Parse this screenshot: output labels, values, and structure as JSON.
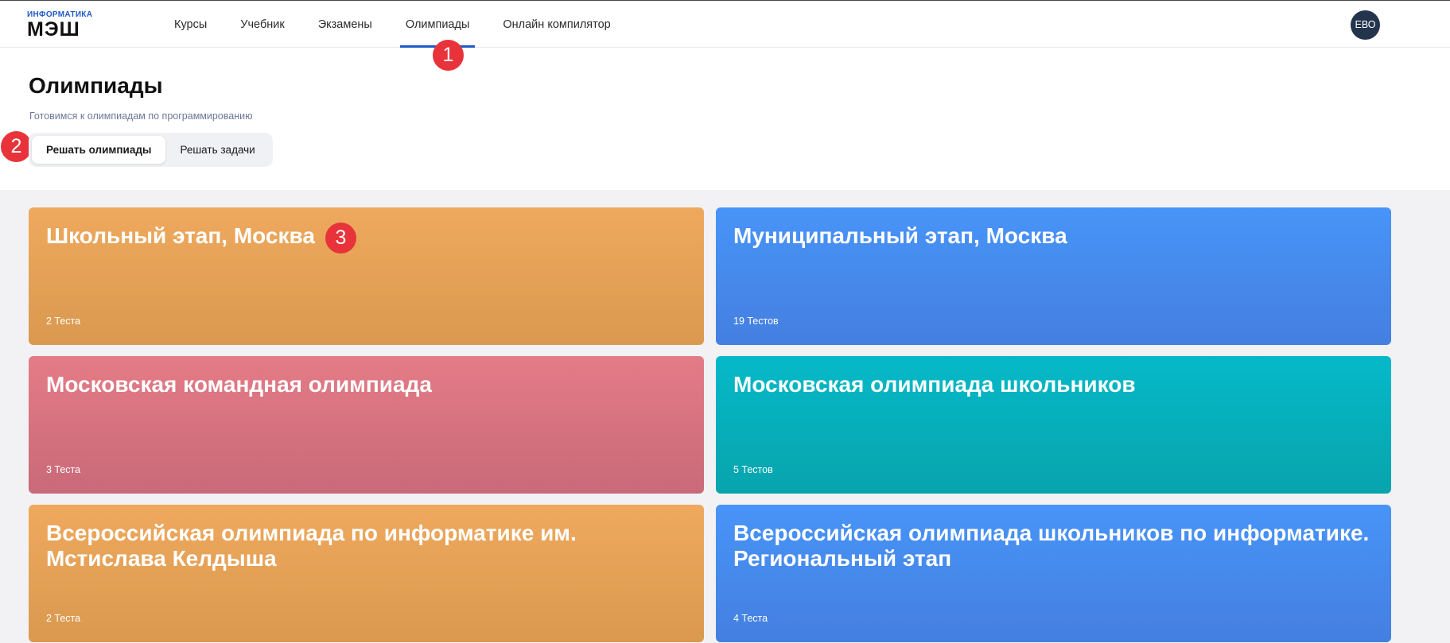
{
  "logo": {
    "small": "ИНФОРМАТИКА",
    "big": "МЭШ"
  },
  "nav": {
    "items": [
      {
        "label": "Курсы"
      },
      {
        "label": "Учебник"
      },
      {
        "label": "Экзамены"
      },
      {
        "label": "Олимпиады"
      },
      {
        "label": "Онлайн компилятор"
      }
    ],
    "active": "Олимпиады"
  },
  "user": {
    "initials": "ЕВО"
  },
  "badges": {
    "b1": "1",
    "b2": "2",
    "b3": "3"
  },
  "page": {
    "title": "Олимпиады",
    "subtitle": "Готовимся к олимпиадам по программированию"
  },
  "tabs": {
    "solve_olympiads": "Решать олимпиады",
    "solve_tasks": "Решать задачи"
  },
  "cards": [
    {
      "title": "Школьный этап, Москва",
      "count": "2 Теста",
      "color": "#efa95e"
    },
    {
      "title": "Муниципальный этап, Москва",
      "count": "19 Тестов",
      "color": "#4894f8"
    },
    {
      "title": "Московская командная олимпиада",
      "count": "3 Теста",
      "color": "#e47c86"
    },
    {
      "title": "Московская олимпиада школьников",
      "count": "5 Тестов",
      "color": "#06b9c8"
    },
    {
      "title": "Всероссийская олимпиада по информатике им. Мстислава Келдыша",
      "count": "2 Теста",
      "color": "#efa95e"
    },
    {
      "title": "Всероссийская олимпиада школьников по информатике. Региональный этап",
      "count": "4 Теста",
      "color": "#4894f8"
    }
  ]
}
